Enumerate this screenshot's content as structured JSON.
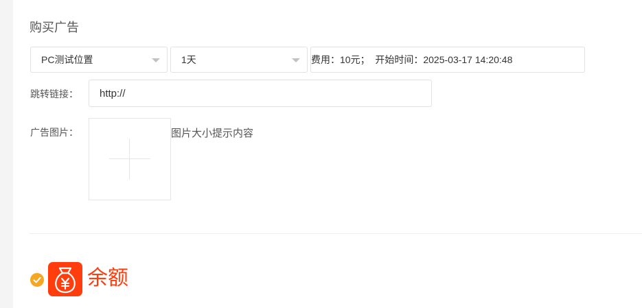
{
  "section_title": "购买广告",
  "position_select": {
    "value": "PC测试位置"
  },
  "duration_select": {
    "value": "1天"
  },
  "order_info": {
    "fee_label": "费用：",
    "fee_value": "10元；",
    "start_label": "开始时间：",
    "start_value": "2025-03-17 14:20:48"
  },
  "link_field": {
    "label": "跳转链接：",
    "value": "http://"
  },
  "image_field": {
    "label": "广告图片：",
    "hint": "图片大小提示内容"
  },
  "payment": {
    "option_title": "余额",
    "icon": "money-bag-icon",
    "selected": true,
    "accent_color": "#ff3d0d",
    "check_color": "#f5a623"
  }
}
